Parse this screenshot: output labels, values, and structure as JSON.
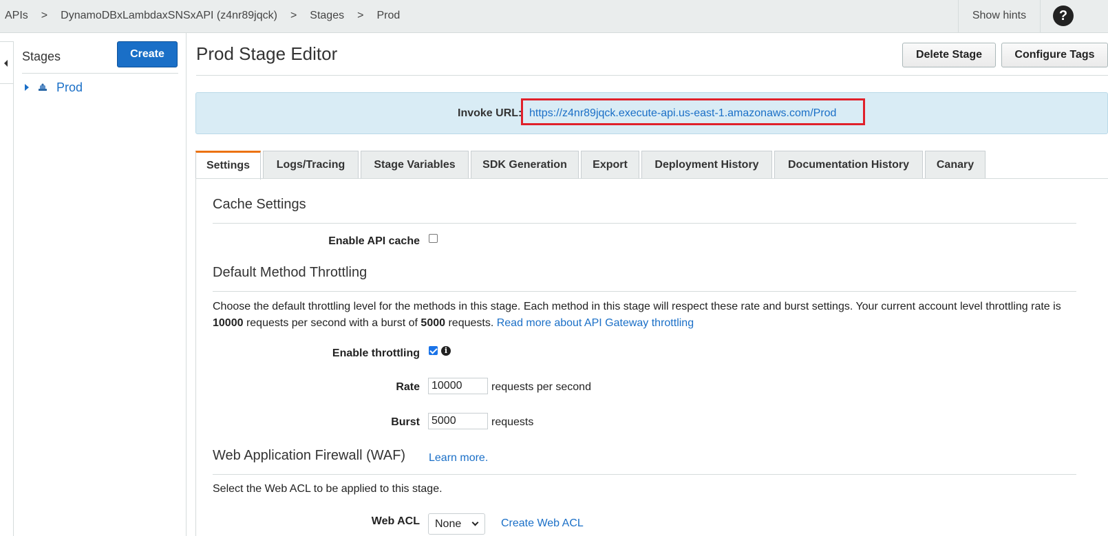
{
  "breadcrumb": {
    "items": [
      "APIs",
      "DynamoDBxLambdaxSNSxAPI (z4nr89jqck)",
      "Stages",
      "Prod"
    ],
    "separator": ">"
  },
  "header": {
    "show_hints": "Show hints",
    "help_icon": "?"
  },
  "sidebar": {
    "title": "Stages",
    "create_label": "Create",
    "stages": [
      {
        "label": "Prod"
      }
    ]
  },
  "main": {
    "title": "Prod Stage Editor",
    "delete_label": "Delete Stage",
    "tags_label": "Configure Tags",
    "invoke_label": "Invoke URL:",
    "invoke_url": "https://z4nr89jqck.execute-api.us-east-1.amazonaws.com/Prod",
    "tabs": [
      "Settings",
      "Logs/Tracing",
      "Stage Variables",
      "SDK Generation",
      "Export",
      "Deployment History",
      "Documentation History",
      "Canary"
    ],
    "active_tab": "Settings"
  },
  "cache": {
    "title": "Cache Settings",
    "enable_label": "Enable API cache",
    "enabled": false
  },
  "throttling": {
    "title": "Default Method Throttling",
    "desc_part1": "Choose the default throttling level for the methods in this stage. Each method in this stage will respect these rate and burst settings. Your current account level throttling rate is ",
    "rate_value": "10000",
    "desc_part2": " requests per second with a burst of ",
    "burst_value": "5000",
    "desc_part3": " requests. ",
    "read_more": "Read more about API Gateway throttling",
    "enable_label": "Enable throttling",
    "enabled": true,
    "rate_label": "Rate",
    "rate_input": "10000",
    "rate_unit": "requests per second",
    "burst_label": "Burst",
    "burst_input": "5000",
    "burst_unit": "requests"
  },
  "waf": {
    "title": "Web Application Firewall (WAF)",
    "learn_more": "Learn more.",
    "desc": "Select the Web ACL to be applied to this stage.",
    "acl_label": "Web ACL",
    "acl_value": "None",
    "create_acl": "Create Web ACL"
  },
  "colors": {
    "link": "#1a6fc7",
    "primary_button": "#1a6fc7",
    "active_tab_accent": "#ec7211",
    "invoke_bg": "#d9ecf5",
    "highlight_border": "#e0202a"
  }
}
